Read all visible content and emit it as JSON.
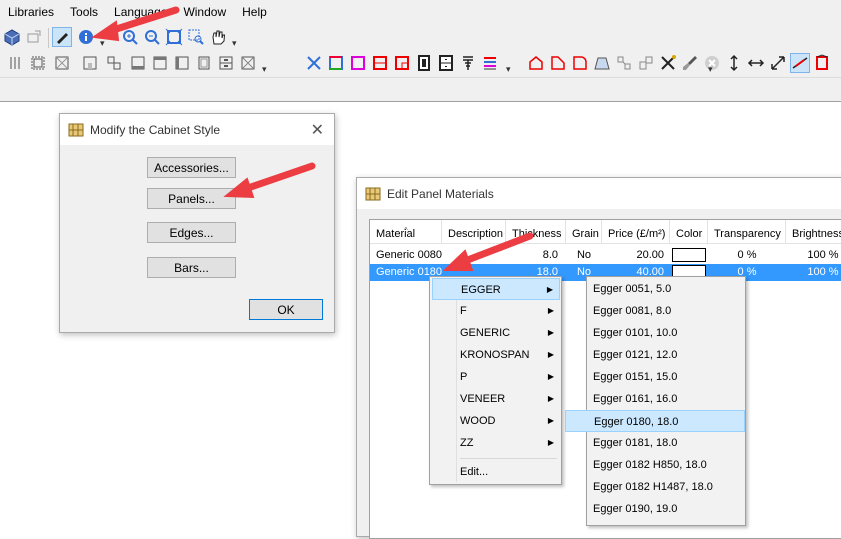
{
  "menubar": {
    "items": [
      "Libraries",
      "Tools",
      "Language",
      "Window",
      "Help"
    ]
  },
  "colors": {
    "accent": "#3399ff",
    "arrow": "#ec3d43",
    "menu_highlight": "#cce8ff"
  },
  "cabinet_dialog": {
    "title": "Modify the Cabinet Style",
    "close_glyph": "✕",
    "buttons": {
      "accessories": "Accessories...",
      "panels": "Panels...",
      "edges": "Edges...",
      "bars": "Bars...",
      "ok": "OK"
    }
  },
  "materials_dialog": {
    "title": "Edit Panel Materials",
    "columns": [
      "Material",
      "Description",
      "Thickness",
      "Grain",
      "Price (£/m²)",
      "Color",
      "Transparency",
      "Brightness"
    ],
    "rows": [
      {
        "material": "Generic 0080",
        "description": "",
        "thickness": "8.0",
        "grain": "No",
        "price": "20.00",
        "transparency": "0 %",
        "brightness": "100 %"
      },
      {
        "material": "Generic 0180",
        "description": "",
        "thickness": "18.0",
        "grain": "No",
        "price": "40.00",
        "transparency": "0 %",
        "brightness": "100 %"
      }
    ]
  },
  "context_menu": {
    "items": [
      "EGGER",
      "F",
      "GENERIC",
      "KRONOSPAN",
      "P",
      "VENEER",
      "WOOD",
      "ZZ"
    ],
    "edit_item": "Edit...",
    "submenu_arrow": "▶"
  },
  "submenu": {
    "items": [
      "Egger 0051, 5.0",
      "Egger 0081, 8.0",
      "Egger 0101, 10.0",
      "Egger 0121, 12.0",
      "Egger 0151, 15.0",
      "Egger 0161, 16.0",
      "Egger 0180, 18.0",
      "Egger 0181, 18.0",
      "Egger 0182 H850, 18.0",
      "Egger 0182 H1487, 18.0",
      "Egger 0190, 19.0"
    ],
    "selected": "Egger 0180, 18.0"
  },
  "toolbar": {
    "grip_glyph": "▾",
    "row1_icons": [
      "3d-view-icon",
      "move-icon",
      "pencil-icon",
      "info-icon",
      "zoom-in-icon",
      "zoom-out-icon",
      "zoom-fit-icon",
      "zoom-window-icon",
      "pan-hand-icon"
    ],
    "row2_icons": [
      "panel-1-icon",
      "panel-2-icon",
      "panel-3-icon",
      "panel-4-icon",
      "panel-5-icon",
      "panel-6-icon",
      "panel-7-icon",
      "panel-8-icon",
      "panel-9-icon",
      "panel-10-icon",
      "panel-11-icon",
      "tools-icon",
      "color-panel-icon",
      "magenta-panel-icon",
      "red-panel-icon",
      "red-grid-icon",
      "door-icon",
      "drawer-icon",
      "hinge-icon",
      "lines-icon",
      "shape-1-icon",
      "shape-2-icon",
      "shape-3-icon",
      "shape-4-icon",
      "shape-5-icon",
      "shape-6-icon",
      "cross-icon",
      "brush-icon",
      "delete-icon",
      "height-icon",
      "width-icon",
      "diagonal-icon",
      "measure-icon",
      "depth-icon"
    ]
  }
}
